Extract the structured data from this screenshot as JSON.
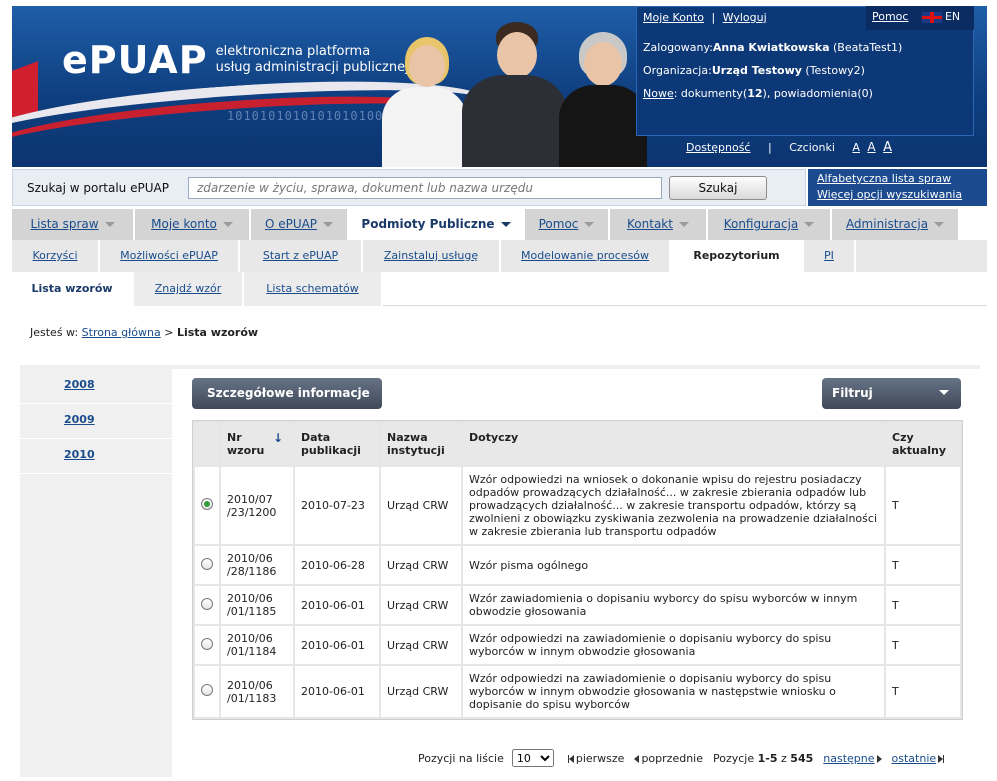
{
  "header": {
    "logo_text": "ePUAP",
    "tagline_1": "elektroniczna platforma",
    "tagline_2": "usług administracji publicznej",
    "binary": "1010101010101010100101010",
    "my_account": "Moje Konto",
    "separator": "|",
    "logout": "Wyloguj",
    "help": "Pomoc",
    "lang": "EN",
    "logged_label": "Zalogowany:",
    "user_name": "Anna Kwiatkowska",
    "user_login": "(BeataTest1)",
    "org_label": "Organizacja:",
    "org_name": "Urząd Testowy",
    "org_code": "(Testowy2)",
    "new_label": "Nowe",
    "new_docs_label": ": dokumenty(",
    "new_docs_count": "12",
    "new_rest": "), powiadomienia(0)",
    "accessibility": "Dostępność",
    "fonts_label": "Czcionki",
    "font_a1": "A",
    "font_a2": "A",
    "font_a3": "A"
  },
  "search": {
    "label": "Szukaj w portalu ePUAP",
    "placeholder": "zdarzenie w życiu, sprawa, dokument lub nazwa urzędu",
    "button": "Szukaj",
    "link_alpha": "Alfabetyczna lista spraw",
    "link_more": "Więcej opcji wyszukiwania"
  },
  "main_nav": [
    "Lista spraw",
    "Moje konto",
    "O ePUAP",
    "Podmioty Publiczne",
    "Pomoc",
    "Kontakt",
    "Konfiguracja",
    "Administracja"
  ],
  "sub_nav": [
    "Korzyści",
    "Możliwości ePUAP",
    "Start z ePUAP",
    "Zainstaluj usługę",
    "Modelowanie procesów",
    "Repozytorium",
    "PI"
  ],
  "third_nav": [
    "Lista wzorów",
    "Znajdź wzór",
    "Lista schematów"
  ],
  "breadcrumb": {
    "prefix": "Jesteś w:",
    "home": "Strona główna",
    "sep": ">",
    "current": "Lista wzorów"
  },
  "years": [
    "2008",
    "2009",
    "2010"
  ],
  "panel": {
    "details_button": "Szczegółowe informacje",
    "filter_button": "Filtruj"
  },
  "table": {
    "headers": {
      "nr": "Nr wzoru",
      "date": "Data publikacji",
      "inst": "Nazwa instytucji",
      "about": "Dotyczy",
      "current": "Czy aktualny"
    },
    "rows": [
      {
        "nr": "2010/07 /23/1200",
        "date": "2010-07-23",
        "inst": "Urząd CRW",
        "about": "Wzór odpowiedzi na wniosek o dokonanie wpisu do rejestru posiadaczy odpadów prowadzących działalność... w zakresie zbierania odpadów lub prowadzących działalność... w zakresie transportu odpadów, którzy są zwolnieni z obowiązku zyskiwania zezwolenia na prowadzenie działalności w zakresie zbierania lub transportu odpadów",
        "current": "T"
      },
      {
        "nr": "2010/06 /28/1186",
        "date": "2010-06-28",
        "inst": "Urząd CRW",
        "about": "Wzór pisma ogólnego",
        "current": "T"
      },
      {
        "nr": "2010/06 /01/1185",
        "date": "2010-06-01",
        "inst": "Urząd CRW",
        "about": "Wzór zawiadomienia o dopisaniu wyborcy do spisu wyborców w innym obwodzie głosowania",
        "current": "T"
      },
      {
        "nr": "2010/06 /01/1184",
        "date": "2010-06-01",
        "inst": "Urząd CRW",
        "about": "Wzór odpowiedzi na zawiadomienie o dopisaniu wyborcy do spisu wyborców w innym obwodzie głosowania",
        "current": "T"
      },
      {
        "nr": "2010/06 /01/1183",
        "date": "2010-06-01",
        "inst": "Urząd CRW",
        "about": "Wzór odpowiedzi na zawiadomienie o dopisaniu wyborcy do spisu wyborców w innym obwodzie głosowania w następstwie wniosku o dopisanie do spisu wyborców",
        "current": "T"
      }
    ],
    "selected_row": 0
  },
  "pager": {
    "per_page_label": "Pozycji na liście",
    "per_page_value": "10",
    "first": "pierwsze",
    "prev": "poprzednie",
    "position_label": "Pozycje",
    "range": "1-5",
    "of": "z",
    "total": "545",
    "next": "następne",
    "last": "ostatnie"
  },
  "colors": {
    "header_blue": "#0f3f80",
    "accent_red": "#e52230",
    "link": "#1a4c8c",
    "radio_checked": "#2f9e3b"
  }
}
